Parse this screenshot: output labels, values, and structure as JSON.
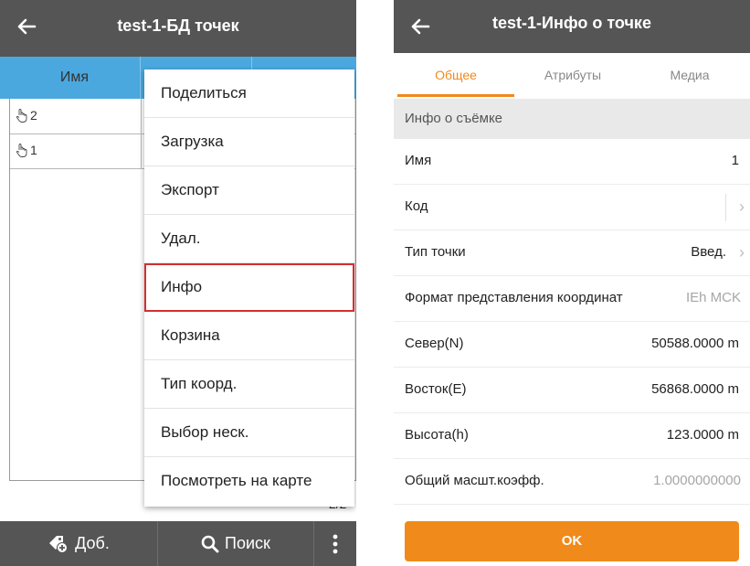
{
  "left": {
    "title": "test-1-БД точек",
    "table": {
      "column_name": "Имя",
      "rows": [
        {
          "name": "2"
        },
        {
          "name": "1"
        }
      ],
      "page_indicator": "2/2"
    },
    "context_menu": {
      "items": [
        {
          "label": "Поделиться"
        },
        {
          "label": "Загрузка"
        },
        {
          "label": "Экспорт"
        },
        {
          "label": "Удал."
        },
        {
          "label": "Инфо"
        },
        {
          "label": "Корзина"
        },
        {
          "label": "Тип коорд."
        },
        {
          "label": "Выбор неск."
        },
        {
          "label": "Посмотреть на карте"
        }
      ],
      "highlighted": "Инфо"
    },
    "bottom_bar": {
      "add_label": "Доб.",
      "search_label": "Поиск"
    }
  },
  "right": {
    "title": "test-1-Инфо о точке",
    "tabs": [
      {
        "label": "Общее"
      },
      {
        "label": "Атрибуты"
      },
      {
        "label": "Медиа"
      }
    ],
    "active_tab": "Общее",
    "section_title": "Инфо о съёмке",
    "fields": [
      {
        "label": "Имя",
        "value": "1"
      },
      {
        "label": "Код",
        "value": ""
      },
      {
        "label": "Тип точки",
        "value": "Введ."
      },
      {
        "label": "Формат представления координат",
        "value": "IEh MCK"
      },
      {
        "label": "Север(N)",
        "value": "50588.0000 m"
      },
      {
        "label": "Восток(E)",
        "value": "56868.0000 m"
      },
      {
        "label": "Высота(h)",
        "value": "123.0000 m"
      },
      {
        "label": "Общий масшт.коэфф.",
        "value": "1.0000000000"
      }
    ],
    "ok_label": "OK"
  },
  "colors": {
    "toolbar": "#555555",
    "header_blue": "#4aa8df",
    "accent_orange": "#f08a1a",
    "highlight_red": "#d32f2f"
  }
}
